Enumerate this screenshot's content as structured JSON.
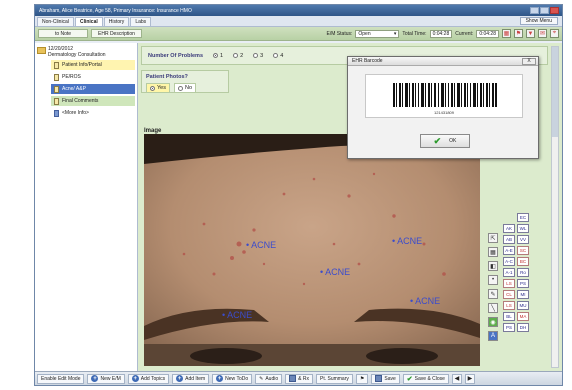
{
  "window": {
    "title": "Abraham, Alice Beatrice, Age 58, Primary Insurance: Insurance HMO",
    "show_menu": "Show Menu"
  },
  "tabs": [
    "Non-Clinical",
    "Clinical",
    "History",
    "Labs"
  ],
  "active_tab": "Clinical",
  "toolbar": {
    "btn1": "to Note",
    "btn2": "EHR Description",
    "em_status_label": "E/M Status:",
    "em_status_value": "Open",
    "total_time_label": "Total Time:",
    "total_time": "0:04:28",
    "current_label": "Current:",
    "current_time": "0:04:28"
  },
  "tree": {
    "date": "12/20/2012",
    "visit": "Dermatology Consultation",
    "items": [
      {
        "label": "Patient Info/Portal",
        "style": "yellow"
      },
      {
        "label": "PE/ROS",
        "style": "plain"
      },
      {
        "label": "Acne/ A&P",
        "style": "selected"
      },
      {
        "label": "Final Comments",
        "style": "green"
      },
      {
        "label": "<More Info>",
        "style": "blue"
      }
    ]
  },
  "problems": {
    "label": "Number Of Problems",
    "options": [
      "1",
      "2",
      "3",
      "4"
    ],
    "selected": "1"
  },
  "photos": {
    "label": "Patient Photos?",
    "yes": "Yes",
    "no": "No",
    "selected": "Yes"
  },
  "image_label": "Image",
  "annotations": [
    "• ACNE",
    "• ACNE",
    "• ACNE",
    "• ACNE",
    "• ACNE"
  ],
  "codes": [
    "EC",
    "AK",
    "WL",
    "AB",
    "VV",
    "A-E",
    "SC",
    "A-C",
    "BC",
    "A-1",
    "Ro",
    "LS",
    "PS",
    "CL",
    "MI",
    "LS",
    "MU",
    "BL",
    "MA",
    "PS",
    "DH"
  ],
  "bottom": {
    "enable_edit": "Enable Edit Mode",
    "new_em": "New E/M",
    "add_topics": "Add Topics",
    "add_item": "Add Item",
    "new_todo": "New ToDo",
    "audio": "Audio",
    "erx": "& Rx",
    "pt_summary": "Pt. Summary",
    "save": "Save",
    "save_close": "Save & Close"
  },
  "dialog": {
    "title": "EHR Barcode",
    "close": "X",
    "barcode_number": "121431809",
    "ok": "OK"
  }
}
